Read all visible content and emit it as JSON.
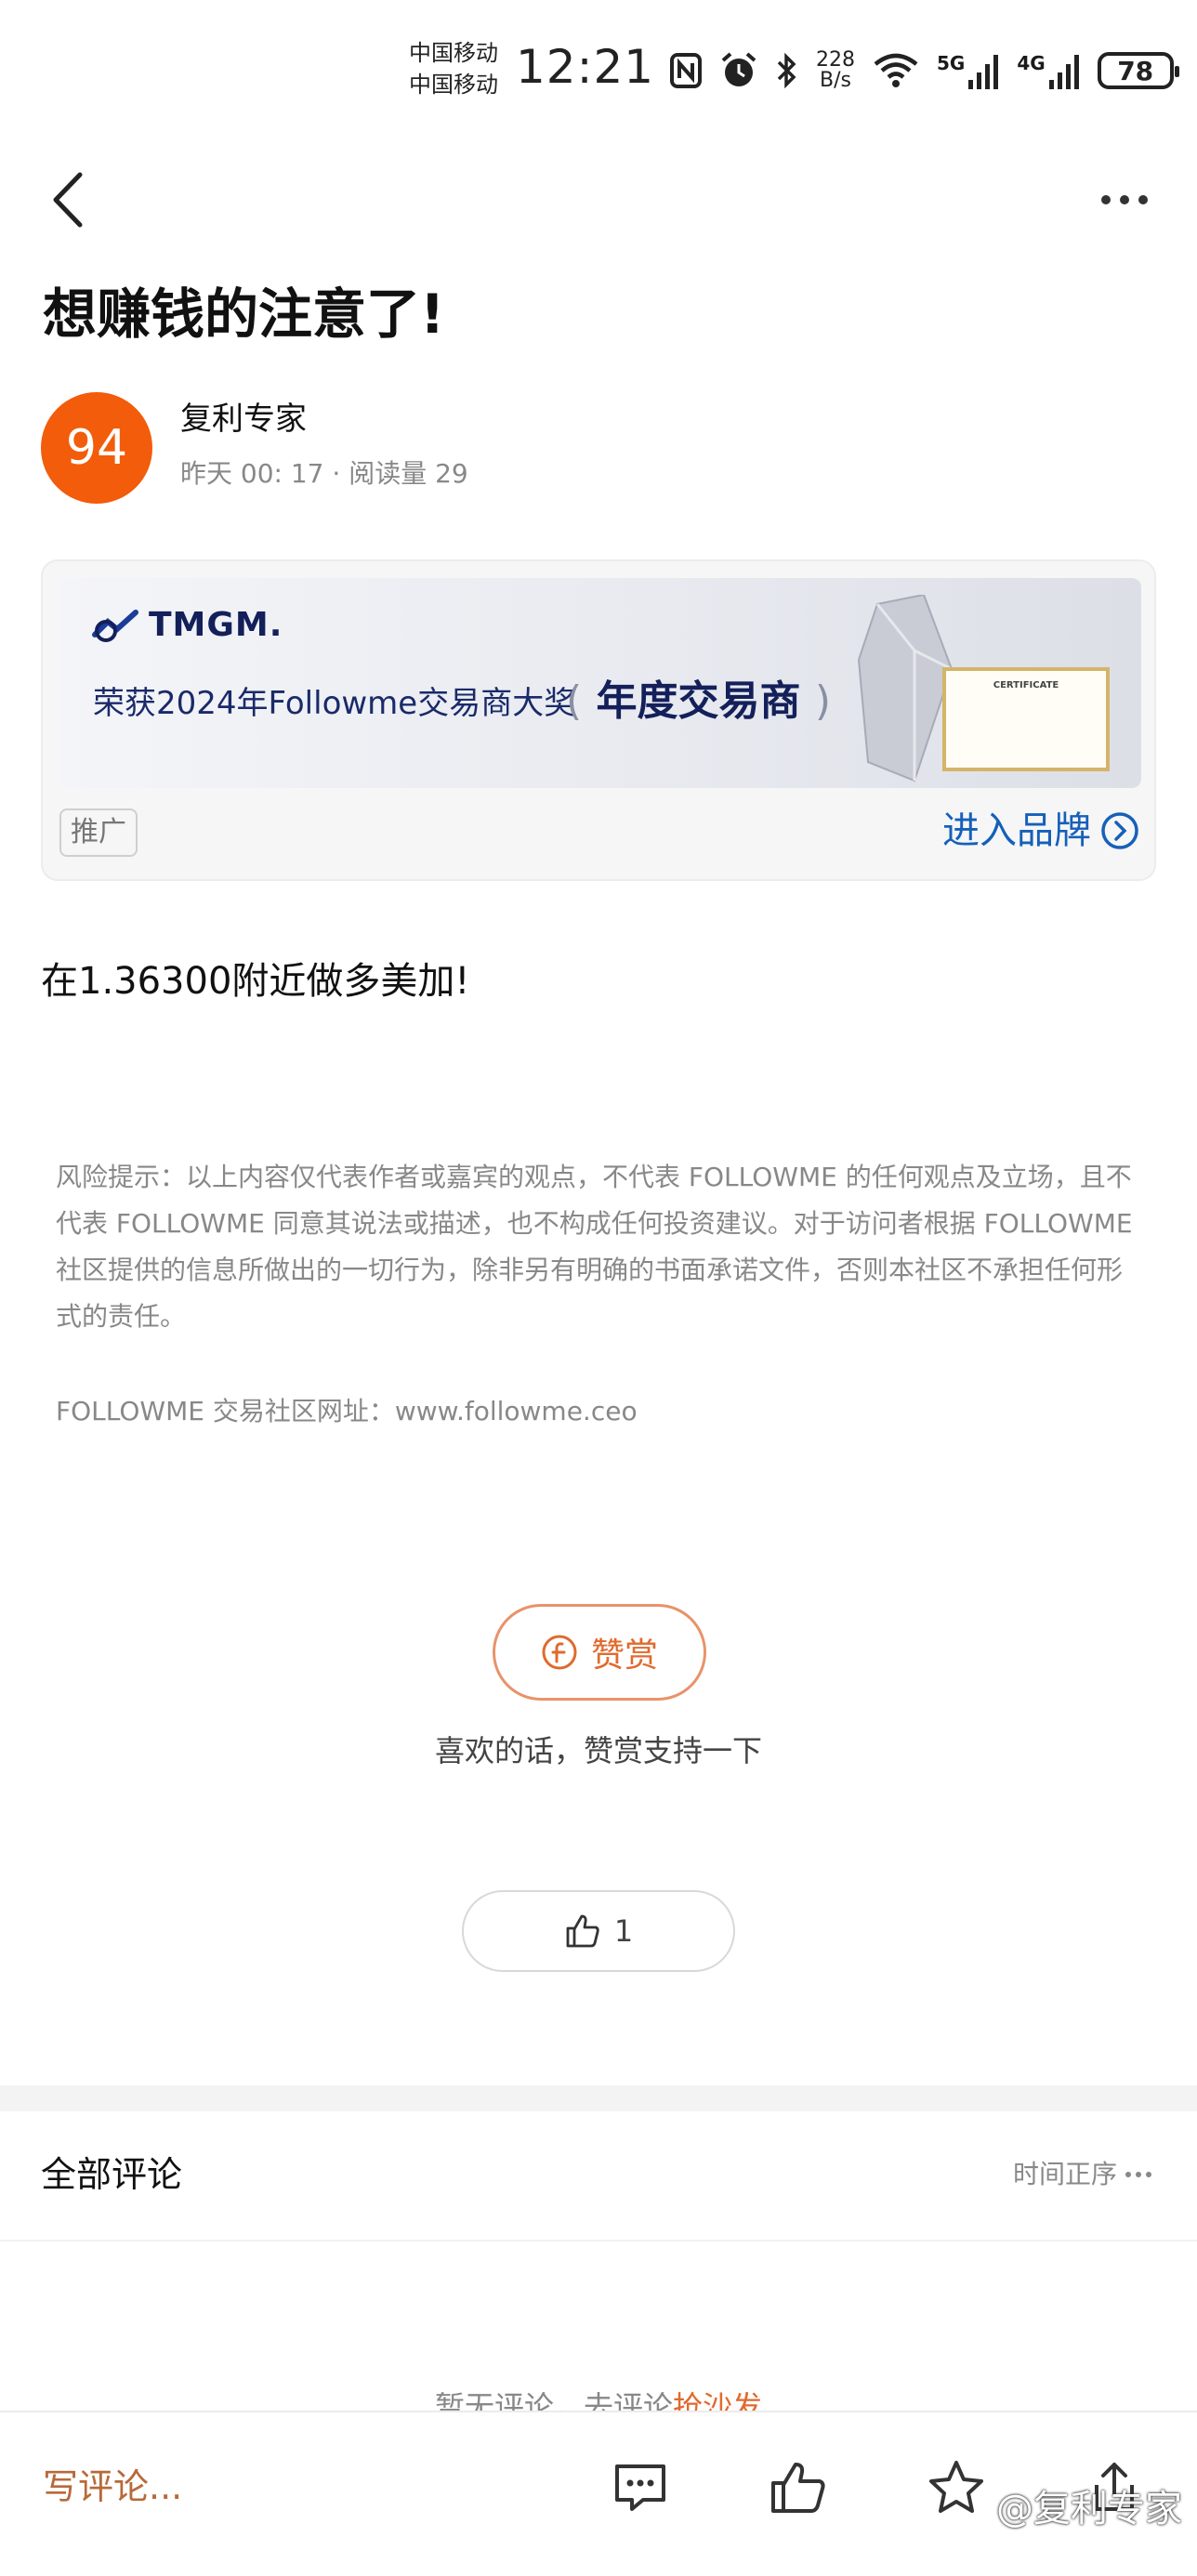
{
  "status_bar": {
    "carrier1": "中国移动",
    "carrier2": "中国移动",
    "time": "12:21",
    "speed_value": "228",
    "speed_unit": "B/s",
    "net1": "5G",
    "net2": "4G",
    "battery": "78"
  },
  "post": {
    "title": "想赚钱的注意了!",
    "author_avatar_text": "94",
    "author": "复利专家",
    "meta": "昨天 00: 17 · 阅读量 29",
    "body": "在1.36300附近做多美加!"
  },
  "ad": {
    "logo": "TMGM.",
    "line": "荣获2024年Followme交易商大奖",
    "award": "年度交易商",
    "cert_title": "CERTIFICATE",
    "tag": "推广",
    "enter": "进入品牌"
  },
  "disclaimer": {
    "risk": "风险提示：以上内容仅代表作者或嘉宾的观点，不代表 FOLLOWME 的任何观点及立场，且不代表 FOLLOWME 同意其说法或描述，也不构成任何投资建议。对于访问者根据 FOLLOWME 社区提供的信息所做出的一切行为，除非另有明确的书面承诺文件，否则本社区不承担任何形式的责任。",
    "site": "FOLLOWME 交易社区网址：www.followme.ceo"
  },
  "reward": {
    "button": "赞赏",
    "hint": "喜欢的话，赞赏支持一下"
  },
  "like": {
    "count": "1"
  },
  "comments": {
    "title": "全部评论",
    "sort": "时间正序",
    "empty_prefix": "暂无评论，去评论",
    "empty_link": "抢沙发"
  },
  "bottom_bar": {
    "write": "写评论...",
    "watermark": "@复利专家"
  },
  "colors": {
    "accent_orange": "#e06a2e",
    "avatar_bg": "#f25c0a",
    "brand_blue": "#1660b8"
  }
}
